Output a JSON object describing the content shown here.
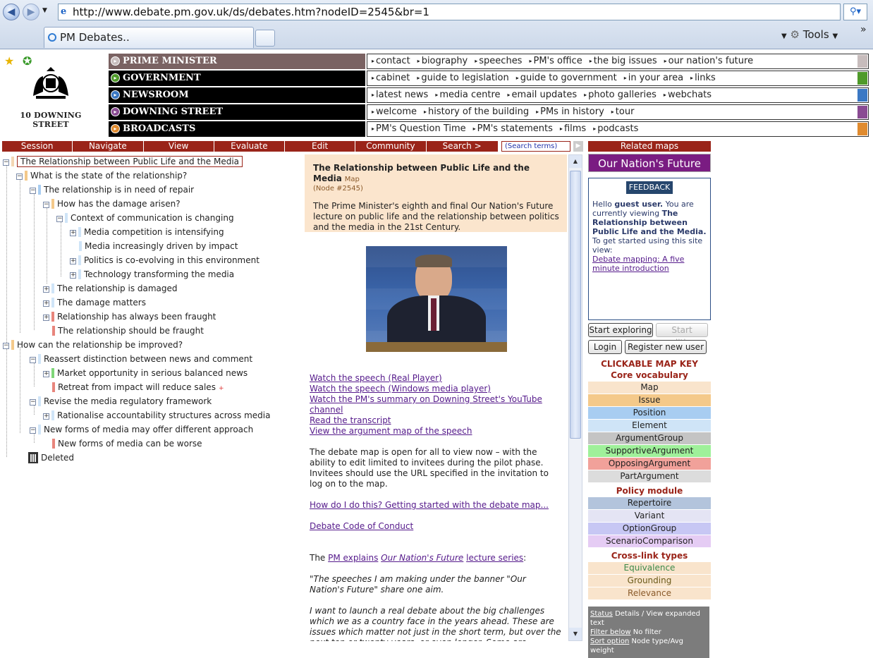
{
  "browser": {
    "url": "http://www.debate.pm.gov.uk/ds/debates.htm?nodeID=2545&br=1",
    "tab_title": "PM Debates..",
    "tools_label": "Tools"
  },
  "site": {
    "logo_text": "10 DOWNING STREET",
    "nav": [
      {
        "label": "PRIME MINISTER",
        "color": "#7a6262",
        "end": "#c7bcbc",
        "links": [
          "contact",
          "biography",
          "speeches",
          "PM's office",
          "the big issues",
          "our nation's future"
        ]
      },
      {
        "label": "GOVERNMENT",
        "color": "#000000",
        "end": "#4f9a2a",
        "links": [
          "cabinet",
          "guide to legislation",
          "guide to government",
          "in your area",
          "links"
        ]
      },
      {
        "label": "NEWSROOM",
        "color": "#000000",
        "end": "#3b78c4",
        "links": [
          "latest news",
          "media centre",
          "email updates",
          "photo galleries",
          "webchats"
        ]
      },
      {
        "label": "DOWNING STREET",
        "color": "#000000",
        "end": "#8a4b93",
        "links": [
          "welcome",
          "history of the building",
          "PMs in history",
          "tour"
        ]
      },
      {
        "label": "BROADCASTS",
        "color": "#000000",
        "end": "#e08b2f",
        "links": [
          "PM's Question Time",
          "PM's statements",
          "films",
          "podcasts"
        ]
      }
    ]
  },
  "menu": [
    "Session",
    "Navigate",
    "View",
    "Evaluate",
    "Edit",
    "Community",
    "Search >"
  ],
  "search_placeholder": "(Search terms)",
  "tree": {
    "root": "The Relationship between Public Life and the Media",
    "n1": "What is the state of the relationship?",
    "n2": "The relationship is in need of repair",
    "n3": "How has the damage arisen?",
    "n4": "Context of communication is changing",
    "n5": "Media competition is intensifying",
    "n6": "Media increasingly driven by impact",
    "n7": "Politics is co-evolving in this environment",
    "n8": "Technology transforming the media",
    "n9": "The relationship is damaged",
    "n10": "The damage matters",
    "n11": "Relationship has always been fraught",
    "n12": "The relationship should be fraught",
    "n13": "How can the relationship be improved?",
    "n14": "Reassert distinction between news and comment",
    "n15": "Market opportunity in serious balanced news",
    "n16": "Retreat from impact will reduce sales",
    "n17": "Revise the media regulatory framework",
    "n18": "Rationalise accountability structures across media",
    "n19": "New forms of media may offer different approach",
    "n20": "New forms of media can be worse",
    "n21": "Deleted"
  },
  "content": {
    "title": "The Relationship between Public Life and the Media",
    "type": "Map",
    "node": "(Node #2545)",
    "desc": "The Prime Minister's eighth and final Our Nation's Future lecture on public life and the relationship between politics and the media in the 21st Century.",
    "links": [
      "Watch the speech (Real Player)",
      "Watch the speech (Windows media player)",
      "Watch the PM's summary on Downing Street's YouTube channel",
      "Read the transcript",
      "View the argument map of the speech"
    ],
    "open_text": "The debate map is open for all to view now – with the ability to edit limited to invitees during the pilot phase. Invitees should use the URL specified in the invitation to log on to the map.",
    "howto": "How do I do this? Getting started with the debate map...",
    "conduct": "Debate Code of Conduct",
    "pm_pre": "The",
    "pm_link1": "PM explains",
    "pm_link2": "Our Nation's Future",
    "pm_link3": "lecture series",
    "pm_post": ":",
    "quote1": "\"The speeches I am making under the banner \"Our Nation's Future\" share one aim.",
    "quote2": "I want to launch a real debate about the big challenges which we as a country face in the years ahead. These are issues which matter not just in the short term, but over the next ten or twenty years, or even longer. Some are subjects which already have a high profile. Others sometimes do not get the attention they deserve."
  },
  "right": {
    "related_head": "Related maps",
    "onf": "Our Nation's Future",
    "feedback": "FEEDBACK",
    "hello": "Hello",
    "guest": "guest user.",
    "viewing": "You are currently viewing",
    "map_name": "The Relationship between Public Life and the Media.",
    "started": "To get started using this site view:",
    "intro_link": "Debate mapping: A five minute introduction",
    "start_exploring": "Start exploring",
    "start_editing": "Start editing",
    "login": "Login",
    "register": "Register new user",
    "key_title": "CLICKABLE MAP KEY",
    "core_title": "Core vocabulary",
    "core": [
      {
        "label": "Map",
        "bg": "#f9e4cc",
        "fg": "#222"
      },
      {
        "label": "Issue",
        "bg": "#f4c98a",
        "fg": "#222"
      },
      {
        "label": "Position",
        "bg": "#a8cdf1",
        "fg": "#222"
      },
      {
        "label": "Element",
        "bg": "#cfe4f7",
        "fg": "#222"
      },
      {
        "label": "ArgumentGroup",
        "bg": "#c4c4c4",
        "fg": "#222"
      },
      {
        "label": "SupportiveArgument",
        "bg": "#9ff09a",
        "fg": "#222"
      },
      {
        "label": "OpposingArgument",
        "bg": "#f1a19a",
        "fg": "#222"
      },
      {
        "label": "PartArgument",
        "bg": "#dcdcdc",
        "fg": "#222"
      }
    ],
    "policy_title": "Policy module",
    "policy": [
      {
        "label": "Repertoire",
        "bg": "#b3c4dc",
        "fg": "#222"
      },
      {
        "label": "Variant",
        "bg": "#e4e4f4",
        "fg": "#222"
      },
      {
        "label": "OptionGroup",
        "bg": "#c7c7f4",
        "fg": "#222"
      },
      {
        "label": "ScenarioComparison",
        "bg": "#e5ccf4",
        "fg": "#222"
      }
    ],
    "cross_title": "Cross-link types",
    "cross": [
      {
        "label": "Equivalence",
        "bg": "#f9e4cc",
        "fg": "#3c8a4a"
      },
      {
        "label": "Grounding",
        "bg": "#f9e4cc",
        "fg": "#6a5a1a"
      },
      {
        "label": "Relevance",
        "bg": "#f9e4cc",
        "fg": "#8a5a2a"
      }
    ],
    "status_link": "Status",
    "status_val": "Details / View expanded text",
    "filter_link": "Filter below",
    "filter_val": "No filter",
    "sort_link": "Sort option",
    "sort_val": "Node type/Avg weight"
  }
}
